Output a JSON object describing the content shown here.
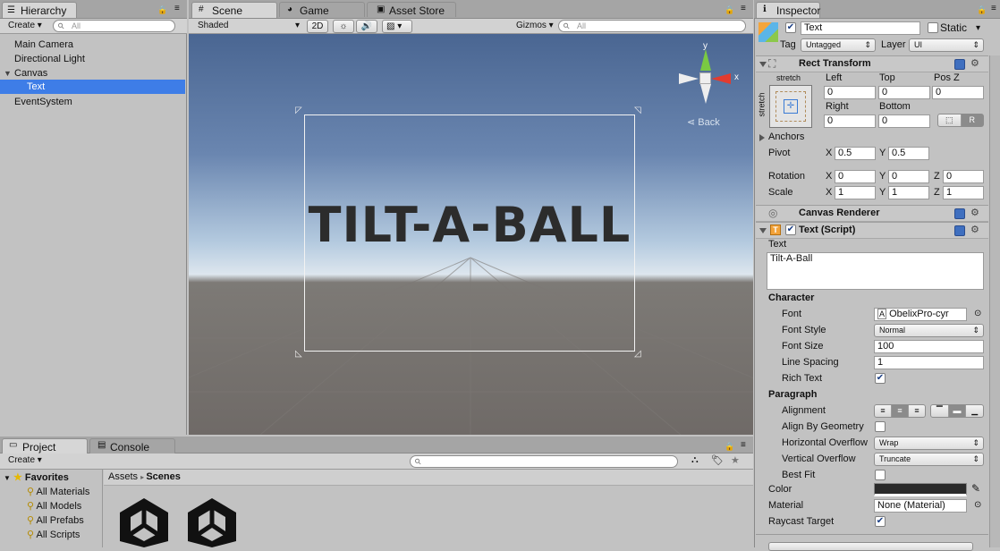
{
  "hierarchy": {
    "tab": "Hierarchy",
    "create": "Create",
    "search_placeholder": "All",
    "items": [
      "Main Camera",
      "Directional Light",
      "Canvas",
      "Text",
      "EventSystem"
    ]
  },
  "scene": {
    "tabs": [
      "Scene",
      "Game",
      "Asset Store"
    ],
    "shading": "Shaded",
    "mode_2d": "2D",
    "gizmos": "Gizmos",
    "search_placeholder": "All",
    "title_text": "TILT-A-BALL",
    "gizmo_x": "x",
    "gizmo_y": "y",
    "back": "Back"
  },
  "inspector": {
    "tab": "Inspector",
    "object_name": "Text",
    "static": "Static",
    "tag_label": "Tag",
    "tag": "Untagged",
    "layer_label": "Layer",
    "layer": "UI",
    "rect": {
      "title": "Rect Transform",
      "stretch_top": "stretch",
      "stretch_side": "stretch",
      "left_lbl": "Left",
      "top_lbl": "Top",
      "posz_lbl": "Pos Z",
      "left": "0",
      "top": "0",
      "posz": "0",
      "right_lbl": "Right",
      "bottom_lbl": "Bottom",
      "right": "0",
      "bottom": "0",
      "r_btn": "R",
      "anchors": "Anchors",
      "pivot": "Pivot",
      "pivot_x": "0.5",
      "pivot_y": "0.5",
      "rotation": "Rotation",
      "rot_x": "0",
      "rot_y": "0",
      "rot_z": "0",
      "scale": "Scale",
      "scale_x": "1",
      "scale_y": "1",
      "scale_z": "1",
      "x": "X",
      "y": "Y",
      "z": "Z"
    },
    "canvas_renderer": "Canvas Renderer",
    "text_script": {
      "title": "Text (Script)",
      "text_lbl": "Text",
      "text_value": "Tilt-A-Ball",
      "character": "Character",
      "font_lbl": "Font",
      "font": "ObelixPro-cyr",
      "font_style_lbl": "Font Style",
      "font_style": "Normal",
      "font_size_lbl": "Font Size",
      "font_size": "100",
      "line_spacing_lbl": "Line Spacing",
      "line_spacing": "1",
      "rich_text_lbl": "Rich Text",
      "paragraph": "Paragraph",
      "alignment_lbl": "Alignment",
      "align_geom_lbl": "Align By Geometry",
      "h_overflow_lbl": "Horizontal Overflow",
      "h_overflow": "Wrap",
      "v_overflow_lbl": "Vertical Overflow",
      "v_overflow": "Truncate",
      "best_fit_lbl": "Best Fit",
      "color_lbl": "Color",
      "material_lbl": "Material",
      "material": "None (Material)",
      "raycast_lbl": "Raycast Target"
    }
  },
  "project": {
    "tabs": [
      "Project",
      "Console"
    ],
    "create": "Create",
    "favorites": "Favorites",
    "fav_items": [
      "All Materials",
      "All Models",
      "All Prefabs",
      "All Scripts"
    ],
    "breadcrumb_root": "Assets",
    "breadcrumb_leaf": "Scenes"
  },
  "colors": {
    "selection": "#3e7de7",
    "text_color_swatch": "#2a2a2a"
  }
}
